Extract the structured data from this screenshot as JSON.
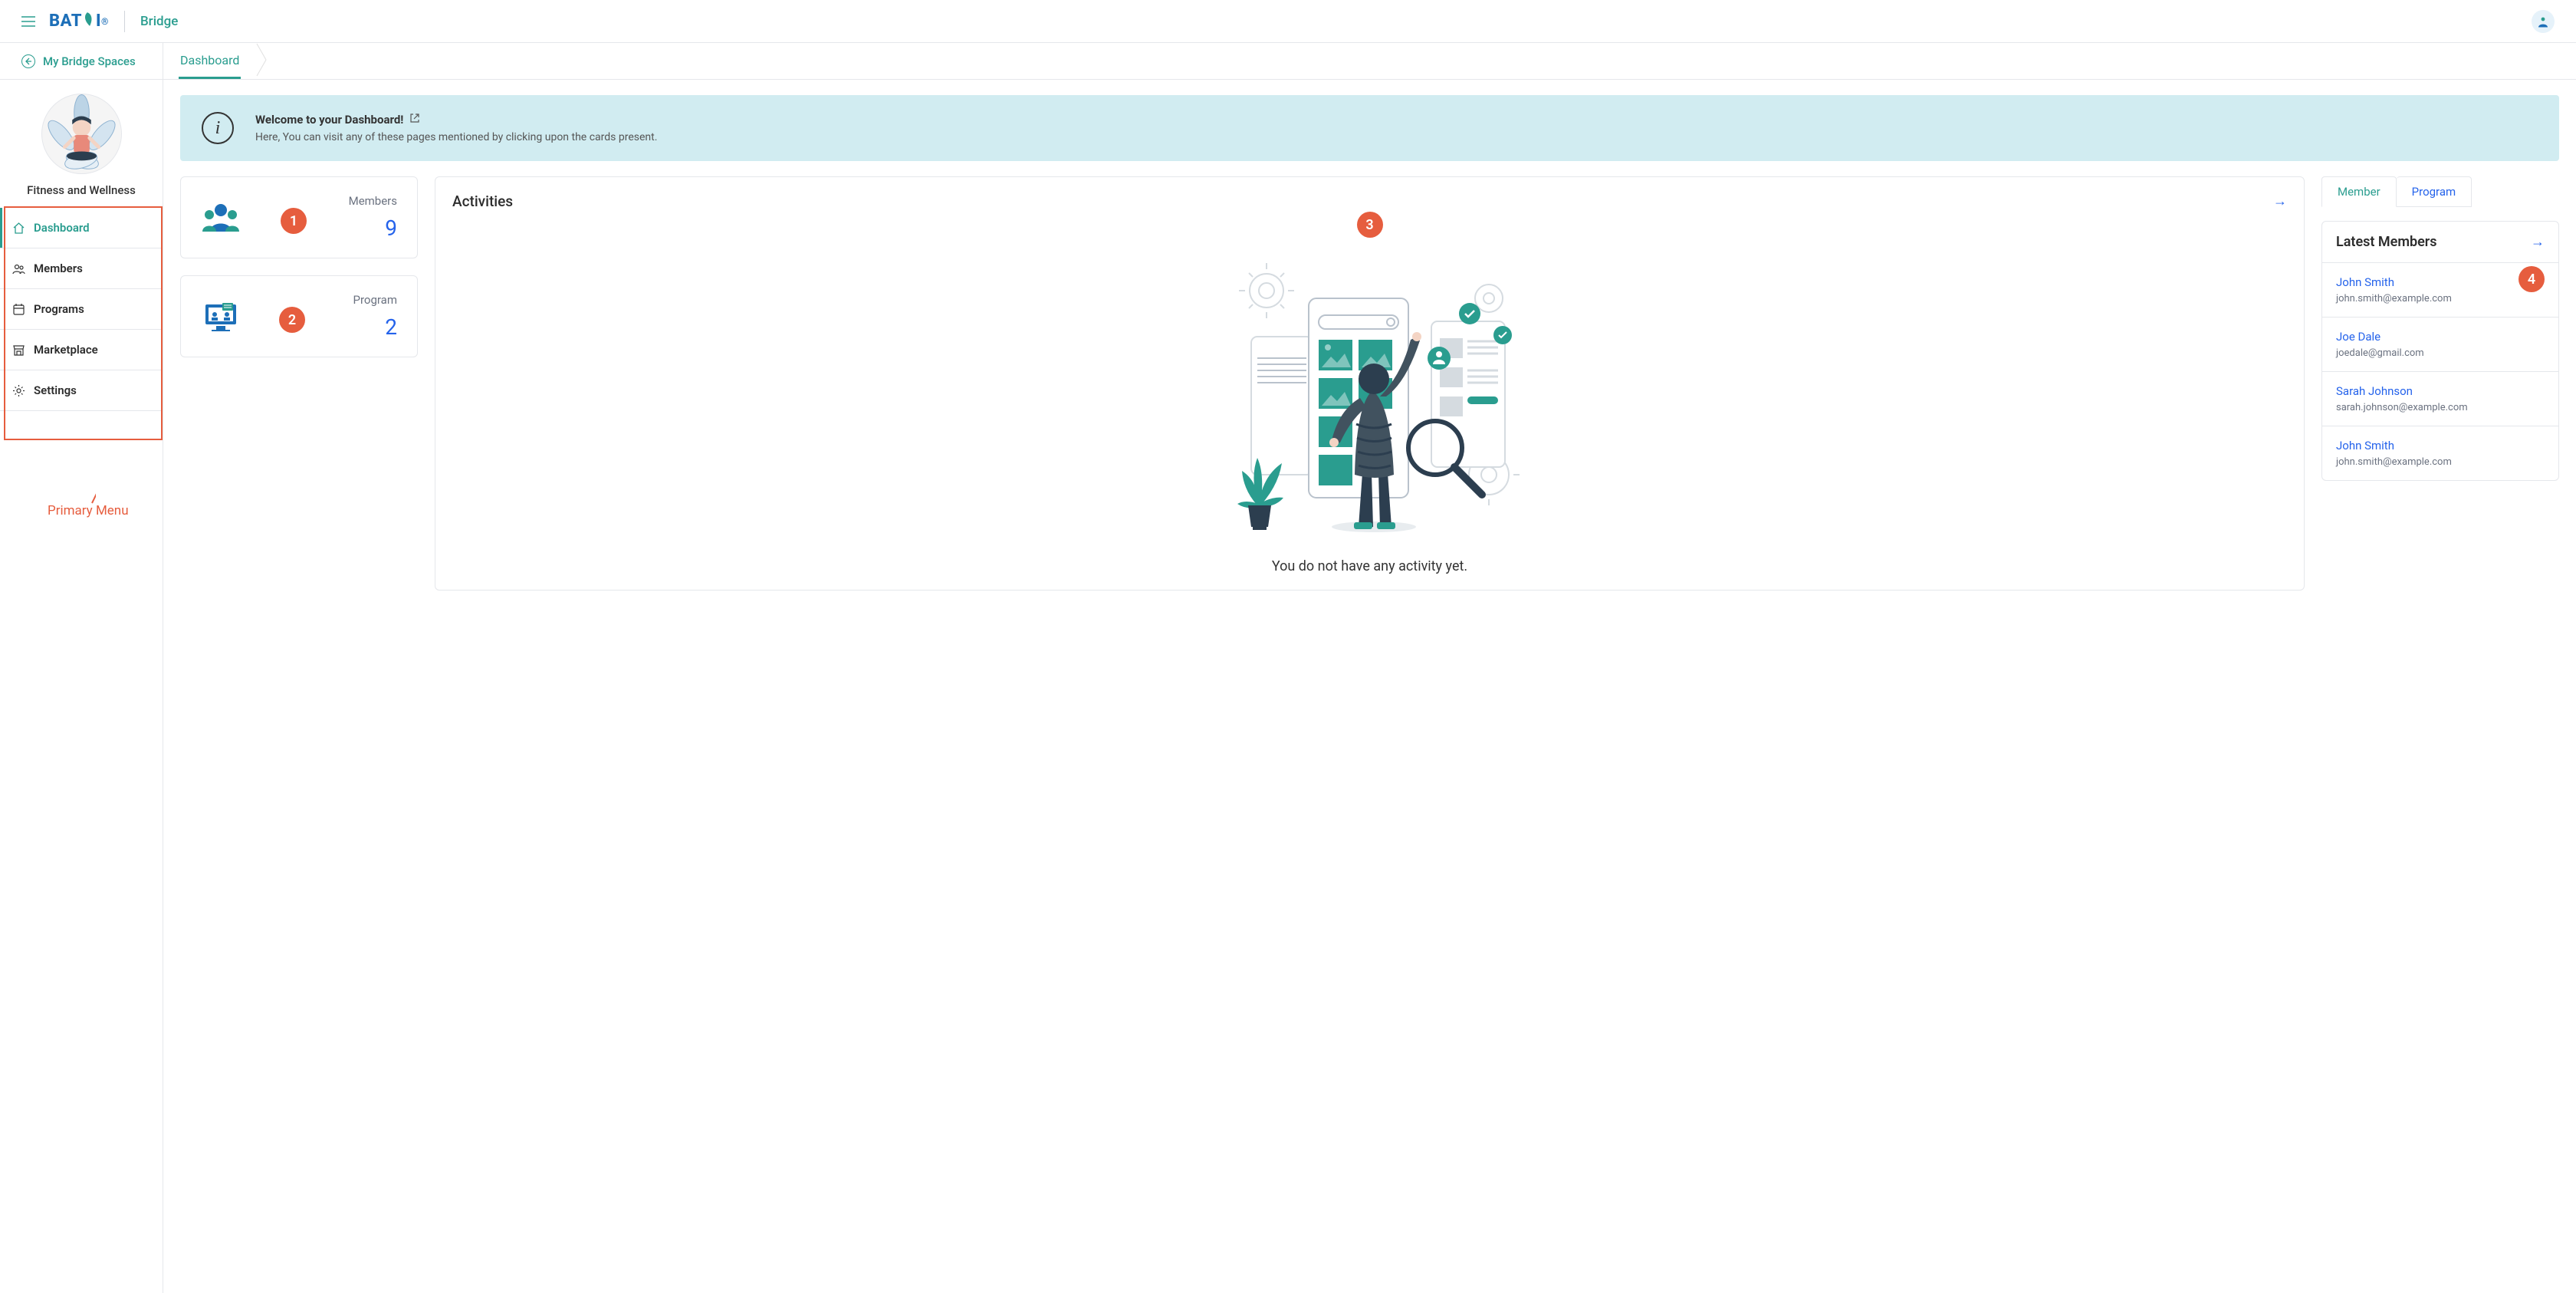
{
  "header": {
    "product": "Bridge",
    "spaces_back": "My Bridge Spaces",
    "breadcrumb": "Dashboard"
  },
  "sidebar": {
    "space_name": "Fitness and Wellness",
    "nav": [
      {
        "label": "Dashboard",
        "icon": "home",
        "active": true
      },
      {
        "label": "Members",
        "icon": "members",
        "active": false
      },
      {
        "label": "Programs",
        "icon": "calendar",
        "active": false
      },
      {
        "label": "Marketplace",
        "icon": "market",
        "active": false
      },
      {
        "label": "Settings",
        "icon": "gear",
        "active": false
      }
    ]
  },
  "annotations": {
    "primary_menu_label": "Primary Menu",
    "callouts": [
      "1",
      "2",
      "3",
      "4"
    ]
  },
  "welcome": {
    "title": "Welcome to your Dashboard!",
    "subtitle": "Here, You can visit any of these pages mentioned by clicking upon the cards present."
  },
  "stats": [
    {
      "label": "Members",
      "value": "9"
    },
    {
      "label": "Program",
      "value": "2"
    }
  ],
  "activities": {
    "title": "Activities",
    "empty_text": "You do not have any activity yet."
  },
  "right_panel": {
    "tabs": [
      {
        "label": "Member",
        "active": true
      },
      {
        "label": "Program",
        "active": false
      }
    ],
    "panel_title": "Latest Members",
    "members": [
      {
        "name": "John Smith",
        "email": "john.smith@example.com"
      },
      {
        "name": "Joe Dale",
        "email": "joedale@gmail.com"
      },
      {
        "name": "Sarah Johnson",
        "email": "sarah.johnson@example.com"
      },
      {
        "name": "John Smith",
        "email": "john.smith@example.com"
      }
    ]
  }
}
